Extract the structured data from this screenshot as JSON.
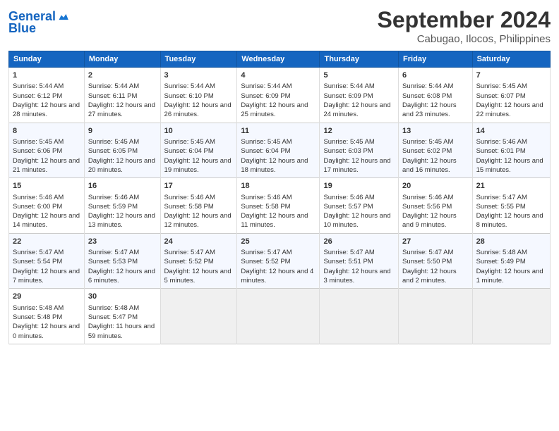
{
  "header": {
    "logo_line1": "General",
    "logo_line2": "Blue",
    "month_title": "September 2024",
    "location": "Cabugao, Ilocos, Philippines"
  },
  "days_of_week": [
    "Sunday",
    "Monday",
    "Tuesday",
    "Wednesday",
    "Thursday",
    "Friday",
    "Saturday"
  ],
  "weeks": [
    [
      {
        "day": "1",
        "sunrise": "Sunrise: 5:44 AM",
        "sunset": "Sunset: 6:12 PM",
        "daylight": "Daylight: 12 hours and 28 minutes."
      },
      {
        "day": "2",
        "sunrise": "Sunrise: 5:44 AM",
        "sunset": "Sunset: 6:11 PM",
        "daylight": "Daylight: 12 hours and 27 minutes."
      },
      {
        "day": "3",
        "sunrise": "Sunrise: 5:44 AM",
        "sunset": "Sunset: 6:10 PM",
        "daylight": "Daylight: 12 hours and 26 minutes."
      },
      {
        "day": "4",
        "sunrise": "Sunrise: 5:44 AM",
        "sunset": "Sunset: 6:09 PM",
        "daylight": "Daylight: 12 hours and 25 minutes."
      },
      {
        "day": "5",
        "sunrise": "Sunrise: 5:44 AM",
        "sunset": "Sunset: 6:09 PM",
        "daylight": "Daylight: 12 hours and 24 minutes."
      },
      {
        "day": "6",
        "sunrise": "Sunrise: 5:44 AM",
        "sunset": "Sunset: 6:08 PM",
        "daylight": "Daylight: 12 hours and 23 minutes."
      },
      {
        "day": "7",
        "sunrise": "Sunrise: 5:45 AM",
        "sunset": "Sunset: 6:07 PM",
        "daylight": "Daylight: 12 hours and 22 minutes."
      }
    ],
    [
      {
        "day": "8",
        "sunrise": "Sunrise: 5:45 AM",
        "sunset": "Sunset: 6:06 PM",
        "daylight": "Daylight: 12 hours and 21 minutes."
      },
      {
        "day": "9",
        "sunrise": "Sunrise: 5:45 AM",
        "sunset": "Sunset: 6:05 PM",
        "daylight": "Daylight: 12 hours and 20 minutes."
      },
      {
        "day": "10",
        "sunrise": "Sunrise: 5:45 AM",
        "sunset": "Sunset: 6:04 PM",
        "daylight": "Daylight: 12 hours and 19 minutes."
      },
      {
        "day": "11",
        "sunrise": "Sunrise: 5:45 AM",
        "sunset": "Sunset: 6:04 PM",
        "daylight": "Daylight: 12 hours and 18 minutes."
      },
      {
        "day": "12",
        "sunrise": "Sunrise: 5:45 AM",
        "sunset": "Sunset: 6:03 PM",
        "daylight": "Daylight: 12 hours and 17 minutes."
      },
      {
        "day": "13",
        "sunrise": "Sunrise: 5:45 AM",
        "sunset": "Sunset: 6:02 PM",
        "daylight": "Daylight: 12 hours and 16 minutes."
      },
      {
        "day": "14",
        "sunrise": "Sunrise: 5:46 AM",
        "sunset": "Sunset: 6:01 PM",
        "daylight": "Daylight: 12 hours and 15 minutes."
      }
    ],
    [
      {
        "day": "15",
        "sunrise": "Sunrise: 5:46 AM",
        "sunset": "Sunset: 6:00 PM",
        "daylight": "Daylight: 12 hours and 14 minutes."
      },
      {
        "day": "16",
        "sunrise": "Sunrise: 5:46 AM",
        "sunset": "Sunset: 5:59 PM",
        "daylight": "Daylight: 12 hours and 13 minutes."
      },
      {
        "day": "17",
        "sunrise": "Sunrise: 5:46 AM",
        "sunset": "Sunset: 5:58 PM",
        "daylight": "Daylight: 12 hours and 12 minutes."
      },
      {
        "day": "18",
        "sunrise": "Sunrise: 5:46 AM",
        "sunset": "Sunset: 5:58 PM",
        "daylight": "Daylight: 12 hours and 11 minutes."
      },
      {
        "day": "19",
        "sunrise": "Sunrise: 5:46 AM",
        "sunset": "Sunset: 5:57 PM",
        "daylight": "Daylight: 12 hours and 10 minutes."
      },
      {
        "day": "20",
        "sunrise": "Sunrise: 5:46 AM",
        "sunset": "Sunset: 5:56 PM",
        "daylight": "Daylight: 12 hours and 9 minutes."
      },
      {
        "day": "21",
        "sunrise": "Sunrise: 5:47 AM",
        "sunset": "Sunset: 5:55 PM",
        "daylight": "Daylight: 12 hours and 8 minutes."
      }
    ],
    [
      {
        "day": "22",
        "sunrise": "Sunrise: 5:47 AM",
        "sunset": "Sunset: 5:54 PM",
        "daylight": "Daylight: 12 hours and 7 minutes."
      },
      {
        "day": "23",
        "sunrise": "Sunrise: 5:47 AM",
        "sunset": "Sunset: 5:53 PM",
        "daylight": "Daylight: 12 hours and 6 minutes."
      },
      {
        "day": "24",
        "sunrise": "Sunrise: 5:47 AM",
        "sunset": "Sunset: 5:52 PM",
        "daylight": "Daylight: 12 hours and 5 minutes."
      },
      {
        "day": "25",
        "sunrise": "Sunrise: 5:47 AM",
        "sunset": "Sunset: 5:52 PM",
        "daylight": "Daylight: 12 hours and 4 minutes."
      },
      {
        "day": "26",
        "sunrise": "Sunrise: 5:47 AM",
        "sunset": "Sunset: 5:51 PM",
        "daylight": "Daylight: 12 hours and 3 minutes."
      },
      {
        "day": "27",
        "sunrise": "Sunrise: 5:47 AM",
        "sunset": "Sunset: 5:50 PM",
        "daylight": "Daylight: 12 hours and 2 minutes."
      },
      {
        "day": "28",
        "sunrise": "Sunrise: 5:48 AM",
        "sunset": "Sunset: 5:49 PM",
        "daylight": "Daylight: 12 hours and 1 minute."
      }
    ],
    [
      {
        "day": "29",
        "sunrise": "Sunrise: 5:48 AM",
        "sunset": "Sunset: 5:48 PM",
        "daylight": "Daylight: 12 hours and 0 minutes."
      },
      {
        "day": "30",
        "sunrise": "Sunrise: 5:48 AM",
        "sunset": "Sunset: 5:47 PM",
        "daylight": "Daylight: 11 hours and 59 minutes."
      },
      null,
      null,
      null,
      null,
      null
    ]
  ]
}
